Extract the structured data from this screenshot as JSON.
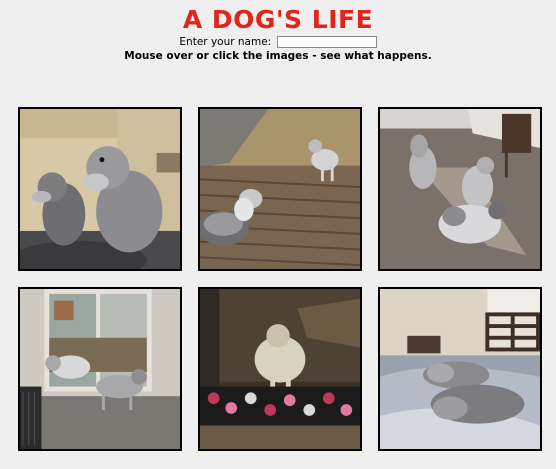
{
  "header": {
    "title": "A DOG'S LIFE",
    "title_color": "#e0251b",
    "name_label": "Enter your name:",
    "name_value": "",
    "hint": "Mouse over or click the images - see what happens."
  },
  "gallery": {
    "images": [
      {
        "name": "dog-photo-1",
        "scene": "two schnauzers on a couch"
      },
      {
        "name": "dog-photo-2",
        "scene": "two schnauzers on a backyard deck"
      },
      {
        "name": "dog-photo-3",
        "scene": "three schnauzers on carpet in sunlight"
      },
      {
        "name": "dog-photo-4",
        "scene": "two schnauzers by a sliding door"
      },
      {
        "name": "dog-photo-5",
        "scene": "schnauzer behind a glass door"
      },
      {
        "name": "dog-photo-6",
        "scene": "schnauzers sleeping on a bed"
      }
    ]
  }
}
